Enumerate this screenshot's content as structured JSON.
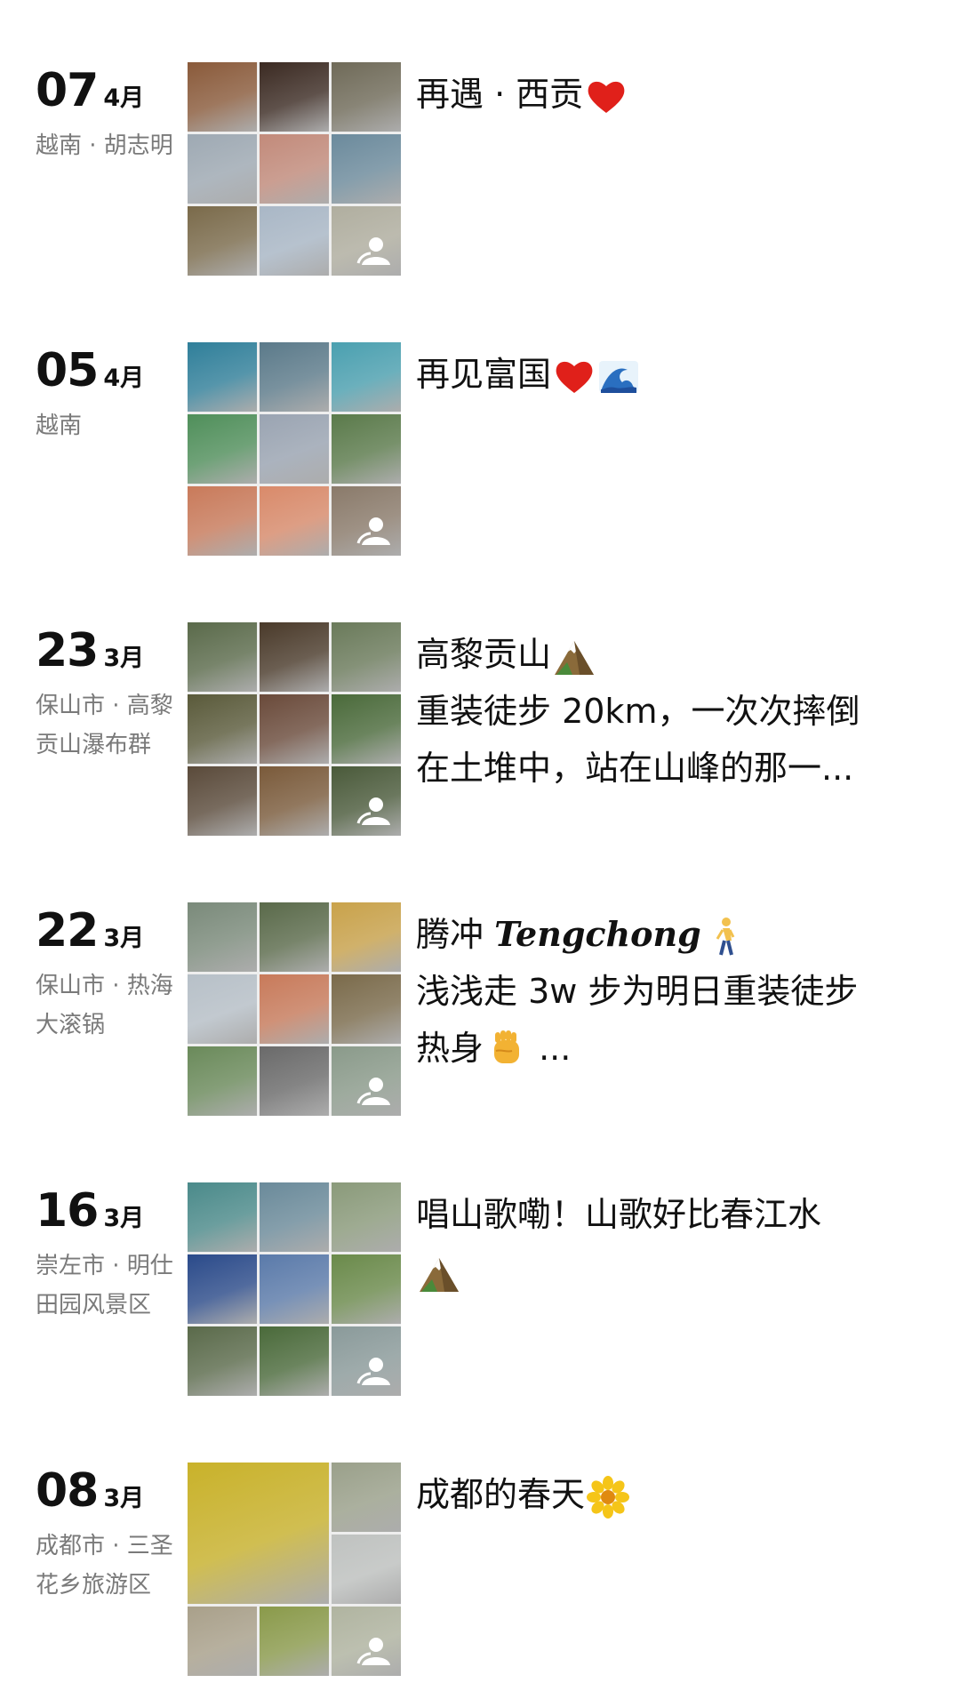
{
  "entries": [
    {
      "day": "07",
      "month": "4月",
      "location": "越南 · 胡志明",
      "lines": [
        {
          "parts": [
            {
              "text": "再遇 · 西贡"
            },
            {
              "emoji": "heart"
            }
          ]
        }
      ],
      "photo_count": 9,
      "colors": [
        "#8a5a3a",
        "#3b2a22",
        "#6f6a58",
        "#9ea9b3",
        "#c28a7a",
        "#6b8a9c",
        "#7a6a4a",
        "#a9b7c6",
        "#b0ae9f"
      ]
    },
    {
      "day": "05",
      "month": "4月",
      "location": "越南",
      "lines": [
        {
          "parts": [
            {
              "text": "再见富国"
            },
            {
              "emoji": "heart"
            },
            {
              "emoji": "wave"
            }
          ]
        }
      ],
      "photo_count": 9,
      "colors": [
        "#2f7f9a",
        "#5b7a8a",
        "#4aa0b0",
        "#4f8f5a",
        "#9aa4b2",
        "#5a7a4a",
        "#c97a5a",
        "#d98a6a",
        "#8a7a6a"
      ]
    },
    {
      "day": "23",
      "month": "3月",
      "location": "保山市 · 高黎贡山瀑布群",
      "lines": [
        {
          "parts": [
            {
              "text": "高黎贡山"
            },
            {
              "emoji": "mountain"
            }
          ]
        },
        {
          "parts": [
            {
              "text": "重装徒步 20km，一次次摔倒"
            }
          ]
        },
        {
          "parts": [
            {
              "text": "在土堆中，站在山峰的那一..."
            }
          ]
        }
      ],
      "photo_count": 9,
      "colors": [
        "#5a6a4a",
        "#4a3a2a",
        "#6a7a5a",
        "#5a5a3a",
        "#6a4a3a",
        "#4a6a3a",
        "#5a4a3a",
        "#7a5a3a",
        "#4a5a3a"
      ]
    },
    {
      "day": "22",
      "month": "3月",
      "location": "保山市 · 热海大滚锅",
      "lines": [
        {
          "parts": [
            {
              "text": "腾冲 "
            },
            {
              "italic": "Tengchong"
            },
            {
              "emoji": "walker"
            }
          ]
        },
        {
          "parts": [
            {
              "text": "浅浅走 3w 步为明日重装徒步"
            }
          ]
        },
        {
          "parts": [
            {
              "text": "热身"
            },
            {
              "emoji": "fist"
            },
            {
              "text": " ..."
            }
          ]
        }
      ],
      "photo_count": 9,
      "colors": [
        "#7a8a7a",
        "#5a6a4a",
        "#c9a24a",
        "#b7c0c8",
        "#c87a5a",
        "#7a6a4a",
        "#6a8a5a",
        "#6a6a6a",
        "#8a9a8a"
      ]
    },
    {
      "day": "16",
      "month": "3月",
      "location": "崇左市 · 明仕田园风景区",
      "lines": [
        {
          "parts": [
            {
              "text": "唱山歌嘞！山歌好比春江水"
            }
          ]
        },
        {
          "parts": [
            {
              "emoji": "mountain"
            }
          ]
        }
      ],
      "photo_count": 9,
      "colors": [
        "#4a8a8a",
        "#6a8a9a",
        "#8a9a7a",
        "#2a4a8a",
        "#5a7aaa",
        "#6a8a4a",
        "#5a6a4a",
        "#4a6a3a",
        "#8a9a9a"
      ]
    },
    {
      "day": "08",
      "month": "3月",
      "location": "成都市 · 三圣花乡旅游区",
      "lines": [
        {
          "parts": [
            {
              "text": "成都的春天"
            },
            {
              "emoji": "flower"
            }
          ]
        }
      ],
      "photo_count": 6,
      "colors": [
        "#c9b22a",
        "#9aa08a",
        "#bfc2c0",
        "#a9a08a",
        "#8a9a4a",
        "#b0b4a0"
      ]
    }
  ]
}
